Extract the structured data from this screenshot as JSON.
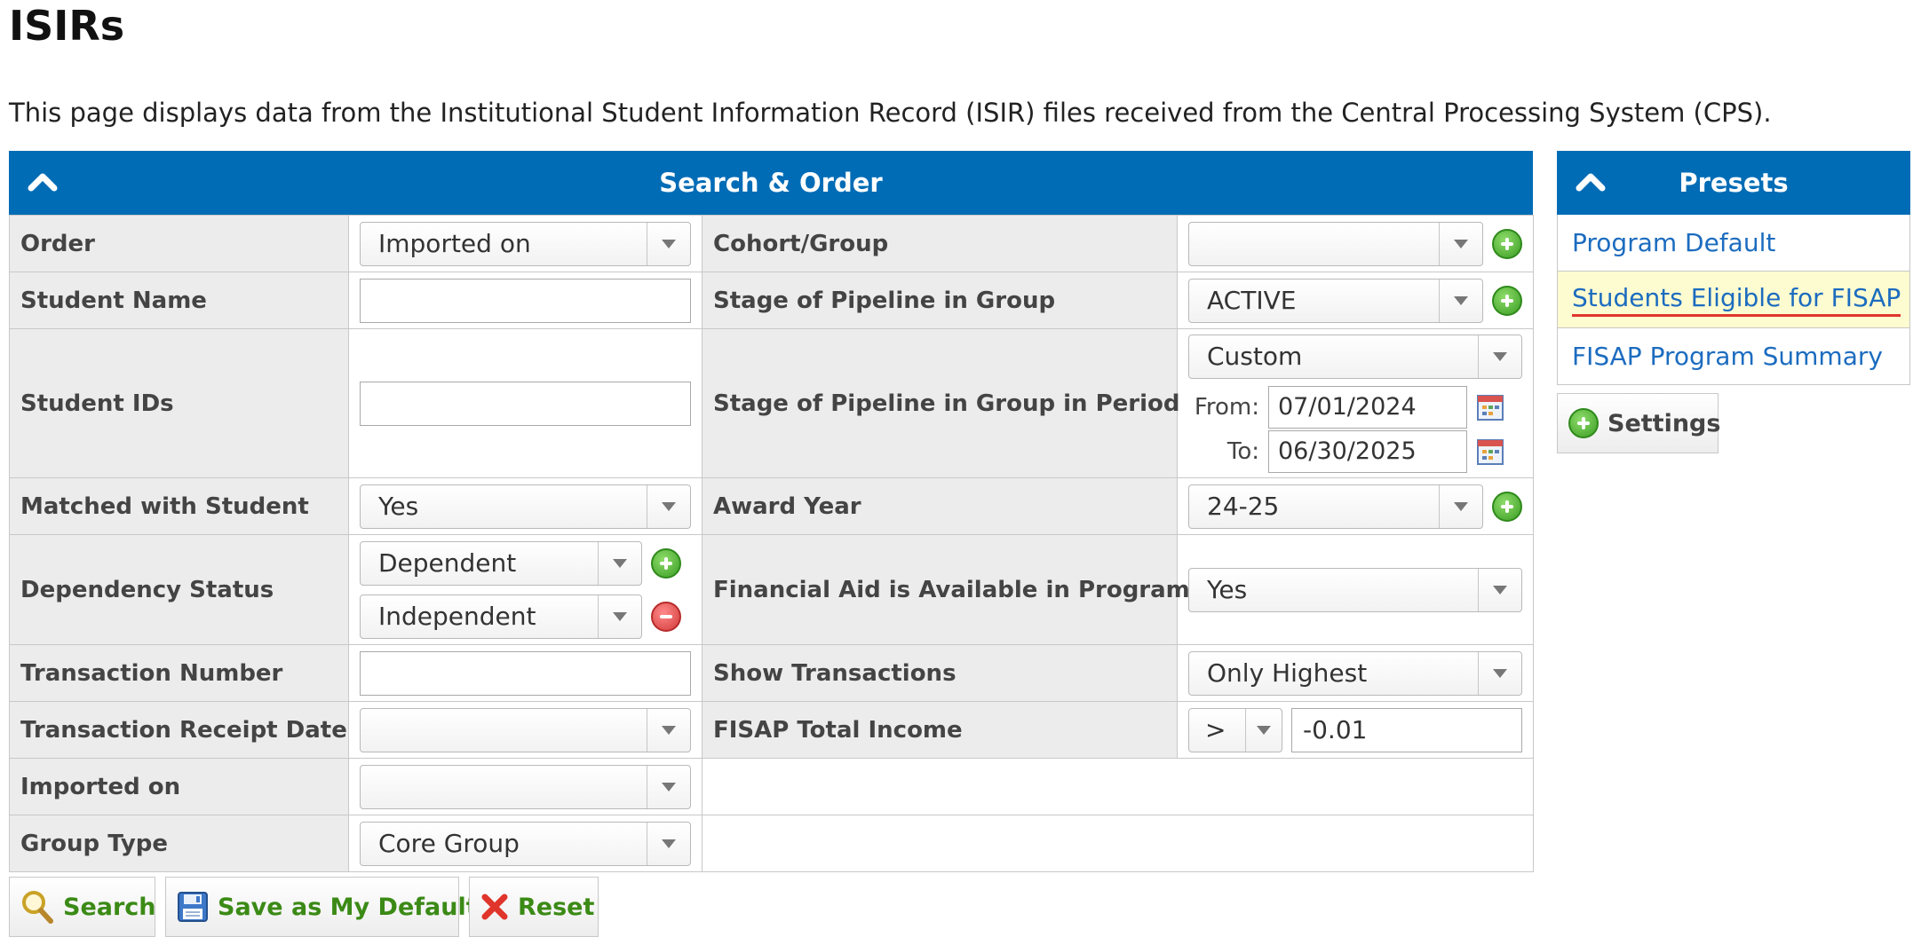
{
  "page": {
    "title": "ISIRs",
    "description": "This page displays data from the Institutional Student Information Record (ISIR) files received from the Central Processing System (CPS)."
  },
  "search_panel": {
    "title": "Search & Order",
    "fields": {
      "order": {
        "label": "Order",
        "value": "Imported on"
      },
      "cohort_group": {
        "label": "Cohort/Group",
        "value": ""
      },
      "student_name": {
        "label": "Student Name",
        "value": ""
      },
      "stage_pipeline": {
        "label": "Stage of Pipeline in Group",
        "value": "ACTIVE"
      },
      "student_ids": {
        "label": "Student IDs",
        "value": ""
      },
      "stage_pipeline_period": {
        "label": "Stage of Pipeline in Group in Period",
        "value": "Custom",
        "from_label": "From:",
        "from_value": "07/01/2024",
        "to_label": "To:",
        "to_value": "06/30/2025"
      },
      "matched_with_student": {
        "label": "Matched with Student",
        "value": "Yes"
      },
      "award_year": {
        "label": "Award Year",
        "value": "24-25"
      },
      "dependency_status": {
        "label": "Dependency Status",
        "values": [
          "Dependent",
          "Independent"
        ]
      },
      "financial_aid_available": {
        "label": "Financial Aid is Available in Program",
        "value": "Yes"
      },
      "transaction_number": {
        "label": "Transaction Number",
        "value": ""
      },
      "show_transactions": {
        "label": "Show Transactions",
        "value": "Only Highest"
      },
      "transaction_receipt_date": {
        "label": "Transaction Receipt Date",
        "value": ""
      },
      "fisap_total_income": {
        "label": "FISAP Total Income",
        "operator": ">",
        "value": "-0.01"
      },
      "imported_on": {
        "label": "Imported on",
        "value": ""
      },
      "group_type": {
        "label": "Group Type",
        "value": "Core Group"
      }
    }
  },
  "presets_panel": {
    "title": "Presets",
    "items": [
      {
        "label": "Program Default"
      },
      {
        "label": "Students Eligible for FISAP"
      },
      {
        "label": "FISAP Program Summary"
      }
    ],
    "settings_label": "Settings"
  },
  "actions": {
    "search_label": "Search",
    "save_default_label": "Save as My Default",
    "reset_label": "Reset"
  },
  "colors": {
    "header_blue": "#006cb6",
    "label_bg": "#ececec",
    "link_blue": "#1c6cbf",
    "active_preset_bg": "#fdfbd0",
    "button_green": "#3b8a16"
  }
}
